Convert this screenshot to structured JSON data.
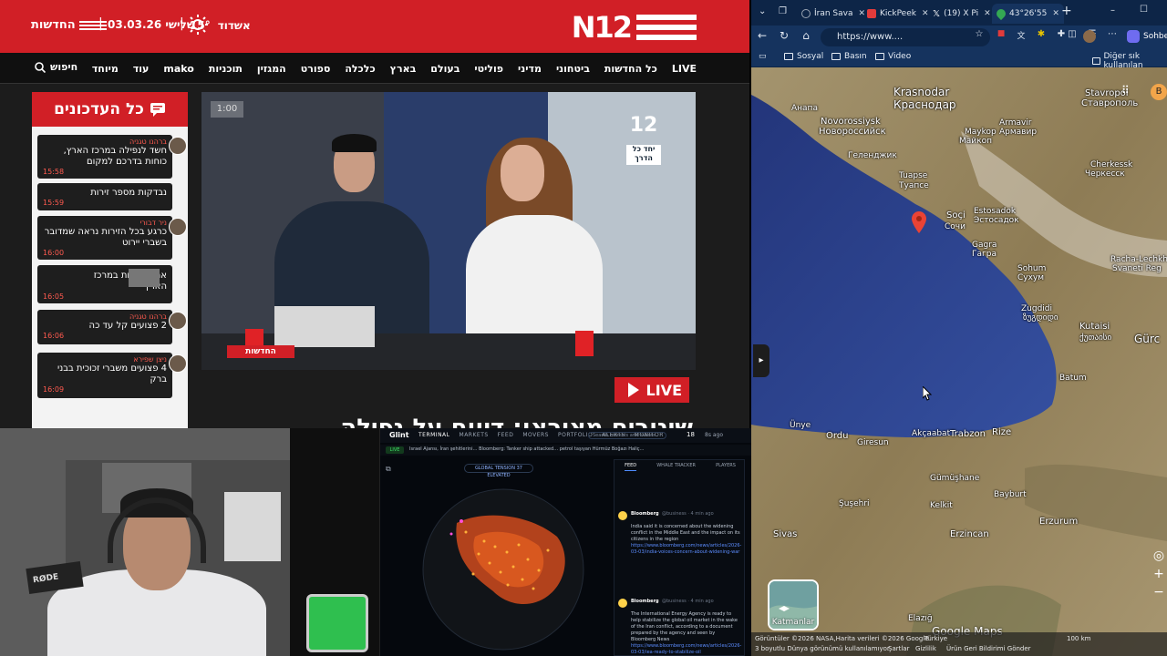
{
  "n12": {
    "brand_name": "החדשות",
    "logo_text": "N12",
    "date": "שלישי 03.03.26",
    "weather_city": "אשדוד",
    "weather_temp": "15°",
    "nav": [
      "LIVE",
      "כל החדשות",
      "ביטחוני",
      "מדיני",
      "פוליטי",
      "בעולם",
      "בארץ",
      "כלכלה",
      "ספורט",
      "המגזין",
      "תוכניות",
      "mako",
      "עוד",
      "מיוחד"
    ],
    "search_label": "חיפוש",
    "updates_title": "כל העדכונים",
    "updates": [
      {
        "author": "ברהנו טגניה",
        "text": "חשד לנפילה במרכז הארץ, כוחות בדרכם למקום",
        "time": "15:58"
      },
      {
        "author": "",
        "text": "נבדקות מספר זירות",
        "time": "15:59"
      },
      {
        "author": "ניר דבורי",
        "text": "כרגע בכל הזירות נראה שמדובר בשברי יירוט",
        "time": "16:00"
      },
      {
        "author": "",
        "text": "אחת הזירות במרכז הארץ",
        "time": "16:05"
      },
      {
        "author": "ברהנו טגניה",
        "text": "2 פצועים קל עד כה",
        "time": "16:06"
      },
      {
        "author": "ניצן שפירא",
        "text": "4 פצועים משברי זכוכית בבני ברק",
        "time": "16:09"
      }
    ],
    "video_time": "1:00",
    "channel_number": "12",
    "channel_sub": "יחד כל הדרך",
    "video_logo": "החדשות",
    "live_label": "LIVE",
    "headline": "שיגורים מאיראן: דיווח על נפילה"
  },
  "browser": {
    "tabs": [
      {
        "title": "İran Sava",
        "color": "#9aa4b2"
      },
      {
        "title": "KickPeek",
        "color": "#e23b3b"
      },
      {
        "title": "(19) X Pi",
        "color": "#ffffff"
      },
      {
        "title": "43°26'55",
        "color": "#34a853"
      }
    ],
    "new_tab": "+",
    "url": "https://www....",
    "bookmarks": [
      "Sosyal",
      "Basın",
      "Video"
    ],
    "other_bookmarks": "Diğer sık kullanılan",
    "profile_label": "Sohbet"
  },
  "map": {
    "labels": [
      {
        "text": "Krasnodar"
      },
      {
        "text": "Краснодар"
      },
      {
        "text": "Stavropol"
      },
      {
        "text": "Ставрополь"
      },
      {
        "text": "Анапа"
      },
      {
        "text": "Novorossiysk"
      },
      {
        "text": "Новороссийск"
      },
      {
        "text": "Геленджик"
      },
      {
        "text": "Armavir"
      },
      {
        "text": "Армавир"
      },
      {
        "text": "Maykop"
      },
      {
        "text": "Майкоп"
      },
      {
        "text": "Cherkessk"
      },
      {
        "text": "Черкесск"
      },
      {
        "text": "Tuapse"
      },
      {
        "text": "Туапсе"
      },
      {
        "text": "Soçi"
      },
      {
        "text": "Сочи"
      },
      {
        "text": "Estosadok"
      },
      {
        "text": "Эстосадок"
      },
      {
        "text": "Gagra"
      },
      {
        "text": "Гагра"
      },
      {
        "text": "Sohum"
      },
      {
        "text": "Сухум"
      },
      {
        "text": "Racha-Lechkh"
      },
      {
        "text": "Svaneti Reg"
      },
      {
        "text": "Zugdidi"
      },
      {
        "text": "ზუგდიდი"
      },
      {
        "text": "Kutaisi"
      },
      {
        "text": "ქუთაისი"
      },
      {
        "text": "Gürc"
      },
      {
        "text": "Batum"
      },
      {
        "text": "Ünye"
      },
      {
        "text": "Ordu"
      },
      {
        "text": "Giresun"
      },
      {
        "text": "Akçaabat"
      },
      {
        "text": "Trabzon"
      },
      {
        "text": "Rize"
      },
      {
        "text": "Gümüşhane"
      },
      {
        "text": "Bayburt"
      },
      {
        "text": "Şuşehri"
      },
      {
        "text": "Kelkit"
      },
      {
        "text": "Erzurum"
      },
      {
        "text": "Erzincan"
      },
      {
        "text": "Sivas"
      },
      {
        "text": "Elazığ"
      }
    ],
    "layers_label": "Katmanlar",
    "footer_left": "Görüntüler ©2026 NASA,Harita verileri ©2026 Google",
    "footer_country": "Türkiye",
    "footer_links": [
      "Şartlar",
      "Gizlilik",
      "Ürün Geri Bildirimi Gönder"
    ],
    "footer_3d": "3 boyutlu Dünya görünümü kullanılamıyor",
    "scale": "100 km",
    "google_logo": "Google Maps"
  },
  "cam": {
    "mic_brand": "RØDE"
  },
  "terminal": {
    "logo": "Glint",
    "menu": [
      "TERMINAL",
      "MARKETS",
      "FEED",
      "MOVERS",
      "PORTFOLIO",
      "ALERTS",
      "MONITOR"
    ],
    "search_placeholder": "Search markets and events",
    "time": "18",
    "time_ago": "8s ago",
    "ticker_live": "LIVE",
    "ticker_text": "Israel Ajansı, İran şehitlerini…  Bloomberg: Tanker ship attacked…  petrol taşıyan Hürmüz Boğazı Haliç…",
    "globe_label": "GLOBAL TENSION",
    "globe_value": "37",
    "globe_state": "ELEVATED",
    "feed_tabs": [
      "FEED",
      "WHALE TRACKER",
      "PLAYERS"
    ],
    "feed": [
      {
        "source": "Bloomberg",
        "handle": "@business · 4 min ago",
        "text": "India said it is concerned about the widening conflict in the Middle East and the impact on its citizens in the region",
        "link": "https://www.bloomberg.com/news/articles/2026-03-03/india-voices-concern-about-widening-war"
      },
      {
        "source": "Bloomberg",
        "handle": "@business · 4 min ago",
        "text": "The International Energy Agency is ready to help stabilize the global oil market in the wake of the Iran conflict, according to a document prepared by the agency and seen by Bloomberg News",
        "link": "https://www.bloomberg.com/news/articles/2026-03-03/iea-ready-to-stabilize-oil"
      }
    ]
  }
}
